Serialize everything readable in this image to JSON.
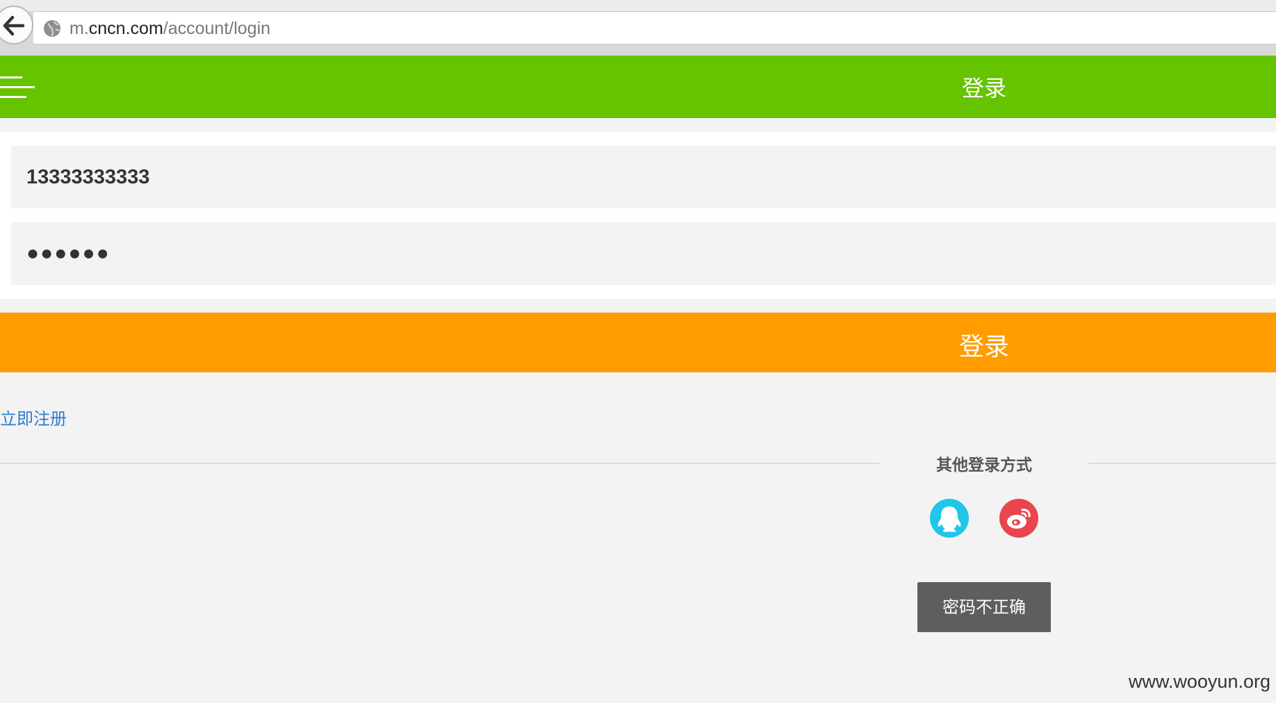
{
  "browser": {
    "url_prefix": "m.",
    "url_domain": "cncn.com",
    "url_path": "/account/login"
  },
  "header": {
    "title": "登录",
    "menu_icon": "hamburger-menu-icon",
    "background_color": "#66c300"
  },
  "form": {
    "phone_value": "13333333333",
    "password_value": "●●●●●●",
    "login_button_label": "登录",
    "login_button_color": "#ff9c00"
  },
  "register": {
    "label": "立即注册",
    "color": "#2b7cd4"
  },
  "other_login": {
    "title": "其他登录方式",
    "methods": [
      {
        "name": "qq",
        "icon": "qq-penguin-icon",
        "color": "#1ec6e8"
      },
      {
        "name": "weibo",
        "icon": "weibo-icon",
        "color": "#e8454f"
      }
    ]
  },
  "toast": {
    "message": "密码不正确"
  },
  "watermark": {
    "text": "www.wooyun.org"
  }
}
